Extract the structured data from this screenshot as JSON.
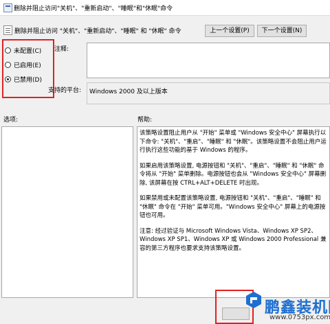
{
  "window": {
    "title": "删除并阻止访问\"关机\"、\"重新启动\"、\"睡眠\"和\"休眠\"命令"
  },
  "header": {
    "policy_name": "删除并阻止访问 \"关机\"、\"重新启动\"、\"睡眠\" 和 \"休眠\" 命令",
    "prev_button": "上一个设置(P)",
    "next_button": "下一个设置(N)"
  },
  "options": {
    "items": [
      {
        "label": "未配置(C)",
        "selected": false
      },
      {
        "label": "已启用(E)",
        "selected": false
      },
      {
        "label": "已禁用(D)",
        "selected": true
      }
    ]
  },
  "comment": {
    "label": "注释:",
    "value": ""
  },
  "supported": {
    "label": "支持的平台:",
    "value": "Windows 2000 及以上版本"
  },
  "sections": {
    "options_label": "选项:",
    "help_label": "帮助:"
  },
  "help": {
    "paragraphs": [
      "该策略设置阻止用户从 \"开始\" 菜单或 \"Windows 安全中心\" 屏幕执行以下命令: \"关机\"、\"重启\"、\"睡眠\" 和 \"休眠\"。该策略设置不会阻止用户运行执行这些功能的基于 Windows 的程序。",
      "如果启用该策略设置, 电源按钮和 \"关机\"、\"重启\"、\"睡眠\" 和 \"休眠\" 命令将从 \"开始\" 菜单删除。电源按钮也会从 \"Windows 安全中心\" 屏幕删除, 该屏幕在按 CTRL+ALT+DELETE 时出现。",
      "如果禁用或未配置该策略设置, 电源按钮和 \"关机\"、\"重启\"、\"睡眠\" 和 \"休眠\" 命令在 \"开始\" 菜单可用。\"Windows 安全中心\" 屏幕上的电源按钮也可用。",
      "注意: 经过验证与 Microsoft Windows Vista、Windows XP SP2、Windows XP SP1、Windows XP 或 Windows 2000 Professional 兼容的第三方程序也要求支持该策略设置。"
    ]
  },
  "watermark": {
    "brand": "鹏鑫装机网",
    "url": "www.0753px.com"
  }
}
